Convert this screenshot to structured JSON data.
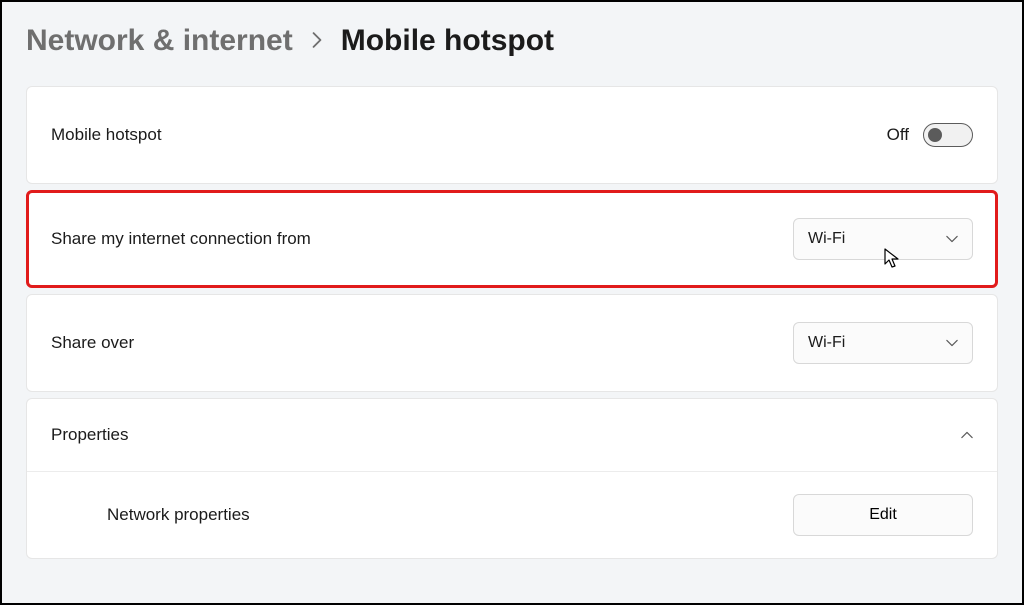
{
  "breadcrumb": {
    "parent": "Network & internet",
    "current": "Mobile hotspot"
  },
  "hotspot": {
    "label": "Mobile hotspot",
    "state_label": "Off"
  },
  "share_from": {
    "label": "Share my internet connection from",
    "selected": "Wi-Fi"
  },
  "share_over": {
    "label": "Share over",
    "selected": "Wi-Fi"
  },
  "properties": {
    "header": "Properties",
    "network_label": "Network properties",
    "edit_label": "Edit"
  }
}
